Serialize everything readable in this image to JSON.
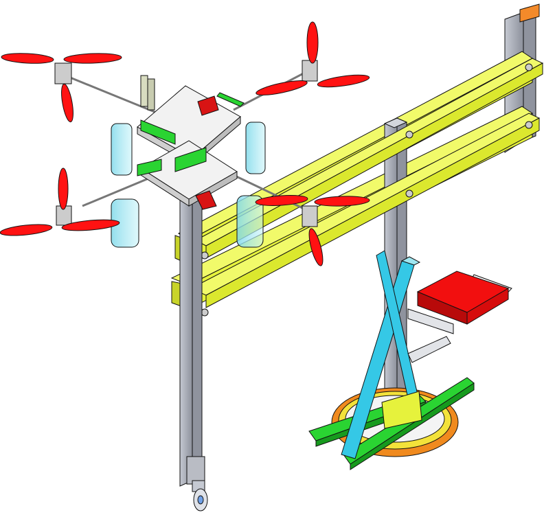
{
  "scene": {
    "description_tag": "cad-isometric-drone-test-rig",
    "colors": {
      "background": "#ffffff",
      "beam_yellow": "#e6f23c",
      "beam_yellow_dark": "#b6c21a",
      "post_gray": "#a9adb8",
      "post_gray_dark": "#6f7380",
      "cyan_frame": "#35c8e6",
      "green_rail": "#22c42a",
      "red_seat": "#f20f0f",
      "red_prop": "#ff1212",
      "orange_ring": "#f08a1e",
      "yellow_ring": "#f3e23a",
      "tank_blue": "#9fe6f0",
      "plate_white": "#f2f2f2",
      "outline": "#111111",
      "corner_orange": "#f38a2a"
    },
    "icons": {
      "propeller": "propeller-icon",
      "motor": "motor-icon",
      "caster": "caster-wheel-icon"
    }
  }
}
